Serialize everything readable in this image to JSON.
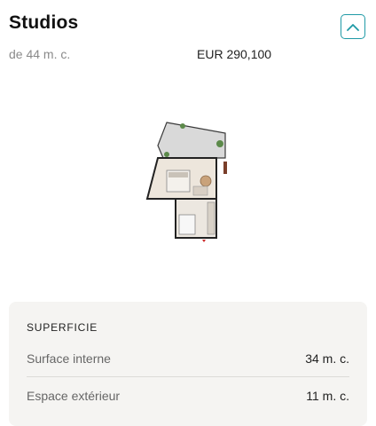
{
  "unit": {
    "title": "Studios",
    "size_from": "de 44 m. c.",
    "price": "EUR 290,100"
  },
  "icons": {
    "collapse": "chevron-up-icon",
    "plan": "floor-plan-image"
  },
  "colors": {
    "accent": "#1f9aa6",
    "panel_bg": "#f5f4f2"
  },
  "superficie": {
    "heading": "SUPERFICIE",
    "rows": [
      {
        "label": "Surface interne",
        "value": "34 m. c."
      },
      {
        "label": "Espace extérieur",
        "value": "11 m. c."
      }
    ]
  }
}
